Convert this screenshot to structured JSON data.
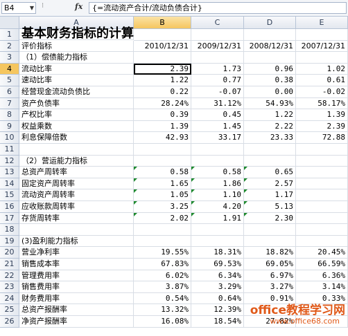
{
  "namebox": "B4",
  "formula": "{=流动资产合计/流动负债合计}",
  "columns": [
    "A",
    "B",
    "C",
    "D",
    "E"
  ],
  "rows": [
    {
      "n": "1",
      "a": "基本财务指标的计算",
      "title": true,
      "v": [
        "",
        "",
        "",
        ""
      ]
    },
    {
      "n": "2",
      "a": "评价指标",
      "v": [
        "2010/12/31",
        "2009/12/31",
        "2008/12/31",
        "2007/12/31"
      ]
    },
    {
      "n": "3",
      "a": "（1）偿债能力指标",
      "v": [
        "",
        "",
        "",
        ""
      ]
    },
    {
      "n": "4",
      "a": "流动比率",
      "v": [
        "2.39",
        "1.73",
        "0.96",
        "1.02"
      ]
    },
    {
      "n": "5",
      "a": "速动比率",
      "v": [
        "1.22",
        "0.77",
        "0.38",
        "0.61"
      ]
    },
    {
      "n": "6",
      "a": "经营现金流动负债比",
      "v": [
        "0.22",
        "-0.07",
        "0.00",
        "-0.02"
      ]
    },
    {
      "n": "7",
      "a": "资产负债率",
      "v": [
        "28.24%",
        "31.12%",
        "54.93%",
        "58.17%"
      ]
    },
    {
      "n": "8",
      "a": "产权比率",
      "v": [
        "0.39",
        "0.45",
        "1.22",
        "1.39"
      ]
    },
    {
      "n": "9",
      "a": "权益乘数",
      "v": [
        "1.39",
        "1.45",
        "2.22",
        "2.39"
      ]
    },
    {
      "n": "10",
      "a": "利息保障倍数",
      "v": [
        "42.93",
        "33.17",
        "23.33",
        "72.88"
      ]
    },
    {
      "n": "11",
      "a": "",
      "v": [
        "",
        "",
        "",
        ""
      ]
    },
    {
      "n": "12",
      "a": "（2）营运能力指标",
      "v": [
        "",
        "",
        "",
        ""
      ]
    },
    {
      "n": "13",
      "a": "总资产周转率",
      "v": [
        "0.58",
        "0.58",
        "0.65",
        ""
      ]
    },
    {
      "n": "14",
      "a": "固定资产周转率",
      "v": [
        "1.65",
        "1.86",
        "2.57",
        ""
      ]
    },
    {
      "n": "15",
      "a": "流动资产周转率",
      "v": [
        "1.05",
        "1.10",
        "1.17",
        ""
      ]
    },
    {
      "n": "16",
      "a": "应收账款周转率",
      "v": [
        "3.25",
        "4.20",
        "5.13",
        ""
      ]
    },
    {
      "n": "17",
      "a": "存货周转率",
      "v": [
        "2.02",
        "1.91",
        "2.30",
        ""
      ]
    },
    {
      "n": "18",
      "a": "",
      "v": [
        "",
        "",
        "",
        ""
      ]
    },
    {
      "n": "19",
      "a": "(3)盈利能力指标",
      "v": [
        "",
        "",
        "",
        ""
      ]
    },
    {
      "n": "20",
      "a": "营业净利率",
      "v": [
        "19.55%",
        "18.31%",
        "18.82%",
        "20.45%"
      ]
    },
    {
      "n": "21",
      "a": "销售成本率",
      "v": [
        "67.83%",
        "69.53%",
        "69.05%",
        "66.59%"
      ]
    },
    {
      "n": "22",
      "a": "管理费用率",
      "v": [
        "6.02%",
        "6.34%",
        "6.97%",
        "6.36%"
      ]
    },
    {
      "n": "23",
      "a": "销售费用率",
      "v": [
        "3.87%",
        "3.29%",
        "3.27%",
        "3.14%"
      ]
    },
    {
      "n": "24",
      "a": "财务费用率",
      "v": [
        "0.54%",
        "0.64%",
        "0.91%",
        "0.33%"
      ]
    },
    {
      "n": "25",
      "a": "总资产报酬率",
      "v": [
        "13.32%",
        "12.39%",
        "",
        ""
      ]
    },
    {
      "n": "26",
      "a": "净资产报酬率",
      "v": [
        "16.08%",
        "18.54%",
        "27.82%",
        ""
      ]
    }
  ],
  "watermark": "office教程学习网",
  "watermark_url": "www.office68.com"
}
